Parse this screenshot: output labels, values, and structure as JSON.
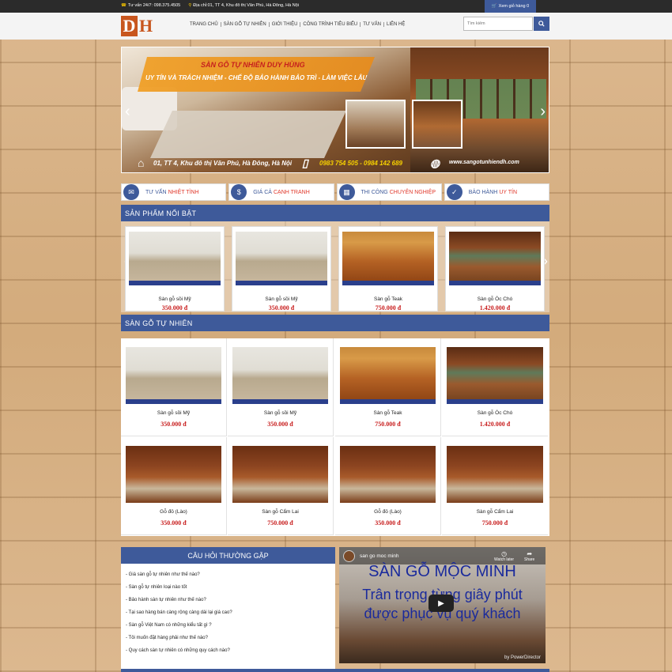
{
  "topbar": {
    "hotline": "Tư vấn 24/7: 098.375.4505",
    "address": "Địa chỉ:01, TT 4, Khu đô thị Văn Phú, Hà Đông, Hà Nội",
    "cart_label": "Xem giỏ hàng 0"
  },
  "header": {
    "logo_d": "D",
    "logo_h": "H",
    "nav": [
      "TRANG CHỦ",
      "SÀN GỖ TỰ NHIÊN",
      "GIỚI THIỆU",
      "CÔNG TRÌNH TIÊU BIỂU",
      "TƯ VẤN",
      "LIÊN HỆ"
    ],
    "search_placeholder": "Tìm kiếm"
  },
  "slider": {
    "title": "SÀN GỖ TỰ NHIÊN DUY HÙNG",
    "subtitle": "UY TÍN VÀ TRÁCH NHIỆM - CHẾ ĐỘ BẢO HÀNH BẢO TRÌ - LÀM VIỆC LÂU DÀI",
    "address": "01, TT 4, Khu đô thị Văn Phú, Hà Đông, Hà Nội",
    "phone": "0983 754 505 - 0984 142 689",
    "website": "www.sangotunhiendh.com"
  },
  "features": [
    {
      "a": "TƯ VẤN",
      "b": "NHIỆT TÌNH",
      "icon": "chat-icon"
    },
    {
      "a": "GIÁ CẢ",
      "b": "CẠNH TRANH",
      "icon": "money-bag-icon"
    },
    {
      "a": "THI CÔNG",
      "b": "CHUYÊN NGHIỆP",
      "icon": "building-icon"
    },
    {
      "a": "BẢO HÀNH",
      "b": "UY TÍN",
      "icon": "check-badge-icon"
    }
  ],
  "featured": {
    "title": "SẢN PHẨM NỔI BẬT",
    "items": [
      {
        "name": "Sàn gỗ sồi Mỹ",
        "price": "350.000 đ"
      },
      {
        "name": "Sàn gỗ sồi Mỹ",
        "price": "350.000 đ"
      },
      {
        "name": "Sàn gỗ Teak",
        "price": "750.000 đ"
      },
      {
        "name": "Sàn gỗ Óc Chó",
        "price": "1.420.000 đ"
      }
    ]
  },
  "natural": {
    "title": "SÀN GỖ TỰ NHIÊN",
    "items": [
      {
        "name": "Sàn gỗ sồi Mỹ",
        "price": "350.000 đ"
      },
      {
        "name": "Sàn gỗ sồi Mỹ",
        "price": "350.000 đ"
      },
      {
        "name": "Sàn gỗ Teak",
        "price": "750.000 đ"
      },
      {
        "name": "Sàn gỗ Óc Chó",
        "price": "1.420.000 đ"
      },
      {
        "name": "Gỗ đỏ (Lào)",
        "price": "350.000 đ"
      },
      {
        "name": "Sàn gỗ Cẩm Lai",
        "price": "750.000 đ"
      },
      {
        "name": "Gỗ đỏ (Lào)",
        "price": "350.000 đ"
      },
      {
        "name": "Sàn gỗ Cẩm Lai",
        "price": "750.000 đ"
      }
    ]
  },
  "faq": {
    "title": "CÂU HỎI THƯỜNG GẶP",
    "items": [
      "- Giá sàn gỗ tự nhiên như thế nào?",
      "- Sàn gỗ tự nhiên loại nào tốt",
      "- Bảo hành sàn tự nhiên như thế nào?",
      "- Tại sao hàng bán càng rộng càng dài lại giá cao?",
      "- Sàn gỗ Việt Nam có những kiểu tất gì ?",
      "- Tôi muốn đặt hàng phải như thế nào?",
      "- Quy cách sàn tự nhiên có những quy cách nào?"
    ]
  },
  "video": {
    "channel": "san go moc minh",
    "headline1": "SÀN GỖ MỘC MINH",
    "headline2": "Trân trọng từng giây phút",
    "headline3": "được phục vụ quý khách",
    "watch_later": "Watch later",
    "share": "Share",
    "watermark": "by PowerDirector"
  }
}
